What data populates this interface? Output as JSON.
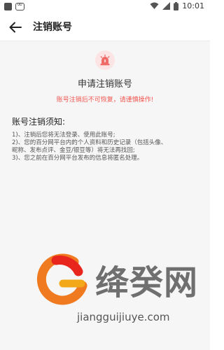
{
  "status_bar": {
    "time": "10:01"
  },
  "header": {
    "title": "注销账号"
  },
  "main": {
    "apply_title": "申请注销账号",
    "warning": "账号注销后不可恢复，请谨慎操作!",
    "notice_heading": "账号注销须知:",
    "notice_items": [
      "1)、注销后您将无法登录、使用此账号;",
      "2)、您的百分网平台内的个人资料和历史记录（包括头像、",
      "昵称、发布点评、金豆/银豆等）将无法再找回;",
      "3)、您之前在百分网平台发布的信息将匿名处理。"
    ]
  },
  "watermark": {
    "name": "绛癸网",
    "url": "jiangguijiuye.com"
  },
  "colors": {
    "warning": "#f3554f",
    "alarm_bg": "#fde4e4",
    "alarm_icon": "#f06a67"
  }
}
